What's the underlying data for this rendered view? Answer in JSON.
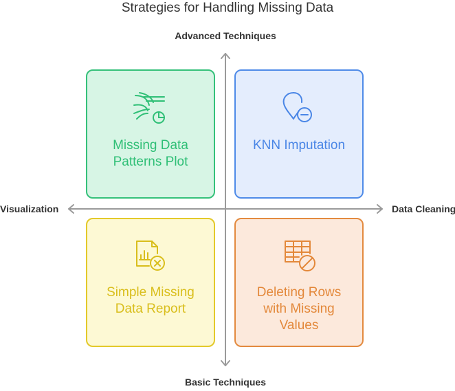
{
  "title": "Strategies for Handling Missing Data",
  "axes": {
    "top": "Advanced Techniques",
    "bottom": "Basic Techniques",
    "left": "Visualization",
    "right": "Data Cleaning"
  },
  "quadrants": {
    "top_left": {
      "lines": [
        "Missing Data",
        "Patterns Plot"
      ],
      "icon": "wind-chart-icon",
      "color": "#35c17a"
    },
    "top_right": {
      "lines": [
        "KNN Imputation"
      ],
      "icon": "location-pin-minus-icon",
      "color": "#4f8be8"
    },
    "bottom_left": {
      "lines": [
        "Simple Missing",
        "Data Report"
      ],
      "icon": "report-x-icon",
      "color": "#e3c92a"
    },
    "bottom_right": {
      "lines": [
        "Deleting Rows",
        "with Missing",
        "Values"
      ],
      "icon": "table-block-icon",
      "color": "#e38a3f"
    }
  }
}
